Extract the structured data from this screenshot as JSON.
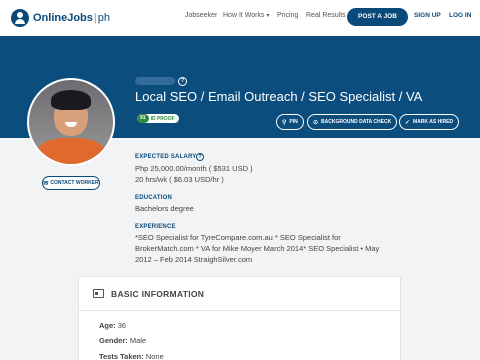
{
  "nav": {
    "logo_name": "OnlineJobs",
    "logo_sep": "|",
    "logo_suffix": "ph",
    "links": {
      "jobseeker": "Jobseeker",
      "how_it_works": "How It Works",
      "pricing": "Pricing",
      "real_results": "Real Results"
    },
    "post_job": "POST A JOB",
    "sign_up": "SIGN UP",
    "log_in": "LOG IN"
  },
  "profile": {
    "title": "Local SEO / Email Outreach / SEO Specialist / VA",
    "id_score": "91",
    "id_label": "ID PROOF",
    "actions": {
      "pin": "PIN",
      "background_check": "BACKGROUND DATA CHECK",
      "mark_hired": "MARK AS HIRED"
    },
    "contact_worker": "CONTACT WORKER"
  },
  "details": {
    "salary_label": "EXPECTED SALARY",
    "salary_monthly": "Php 25,000.00/month ( $531 USD )",
    "salary_hourly": "20 hrs/wk ( $6.03 USD/hr )",
    "education_label": "EDUCATION",
    "education_value": "Bachelors degree",
    "experience_label": "EXPERIENCE",
    "experience_line1": "*SEO Specialist for TyreCompare.com.au * SEO Specialist for",
    "experience_line2": "BrokerMatch.com * VA for Mike Moyer March 2014* SEO Specialist • May",
    "experience_line3": "2012 – Feb 2014 StraighSilver.com"
  },
  "basic_info": {
    "heading": "BASIC INFORMATION",
    "age_label": "Age:",
    "age_value": "36",
    "gender_label": "Gender:",
    "gender_value": "Male",
    "tests_label": "Tests Taken:",
    "tests_value": "None"
  },
  "colors": {
    "brand": "#0a4a7a",
    "banner": "#0b4d7c",
    "id_green": "#2e8b3f"
  },
  "icons": {
    "pin": "pin-icon",
    "background_check": "shield-search-icon",
    "mark_hired": "check-circle-icon",
    "contact": "envelope-icon",
    "help": "question-circle-icon",
    "card": "id-card-icon"
  }
}
